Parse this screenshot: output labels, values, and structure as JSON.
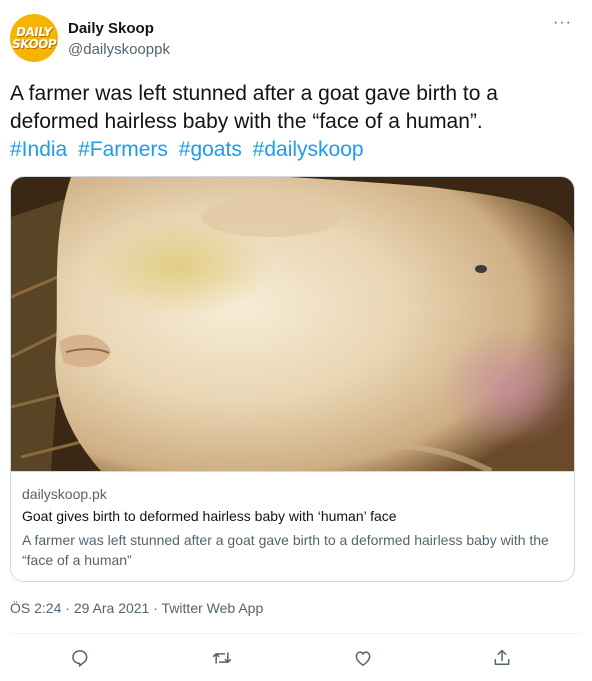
{
  "author": {
    "name": "Daily Skoop",
    "handle": "@dailyskooppk",
    "avatar_text_top": "DAILY",
    "avatar_text_bottom": "SKOOP"
  },
  "more_label": "···",
  "tweet": {
    "text": "A farmer was left stunned after a goat gave birth to a deformed hairless baby with the “face of a human”.",
    "hashtags": [
      "#India",
      "#Farmers",
      "#goats",
      "#dailyskoop"
    ]
  },
  "card": {
    "domain": "dailyskoop.pk",
    "title": "Goat gives birth to deformed hairless baby with ‘human’ face",
    "description": "A farmer was left stunned after a goat gave birth to a deformed hairless baby with the “face of a human”"
  },
  "meta": {
    "time": "ÖS 2:24",
    "date": "29 Ara 2021",
    "source": "Twitter Web App",
    "separator": "·"
  },
  "actions": [
    "reply-icon",
    "retweet-icon",
    "like-icon",
    "share-icon"
  ],
  "colors": {
    "link": "#1d9bf0",
    "secondary_text": "#536471",
    "border": "#cfd9de",
    "avatar_bg": "#f5b400"
  }
}
